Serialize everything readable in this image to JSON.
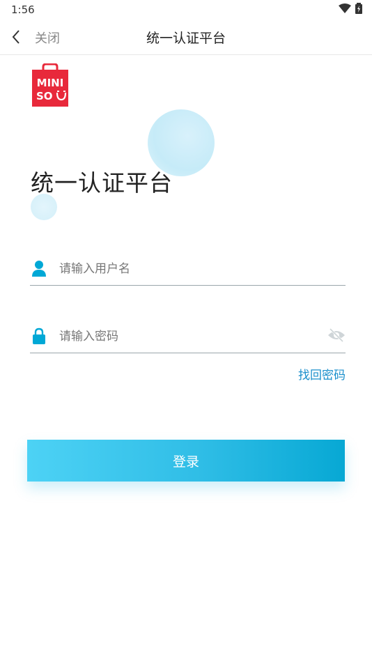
{
  "status": {
    "time": "1:56",
    "icons": [
      "wifi-icon",
      "battery-icon"
    ]
  },
  "nav": {
    "close_label": "关闭",
    "title": "统一认证平台"
  },
  "logo": {
    "line1": "MINI",
    "line2": "SO"
  },
  "heading": "统一认证平台",
  "form": {
    "username_placeholder": "请输入用户名",
    "password_placeholder": "请输入密码",
    "forgot_label": "找回密码",
    "login_label": "登录"
  },
  "colors": {
    "accent": "#00a8d6",
    "brand_red": "#e8293b",
    "link": "#1a8fcc"
  }
}
